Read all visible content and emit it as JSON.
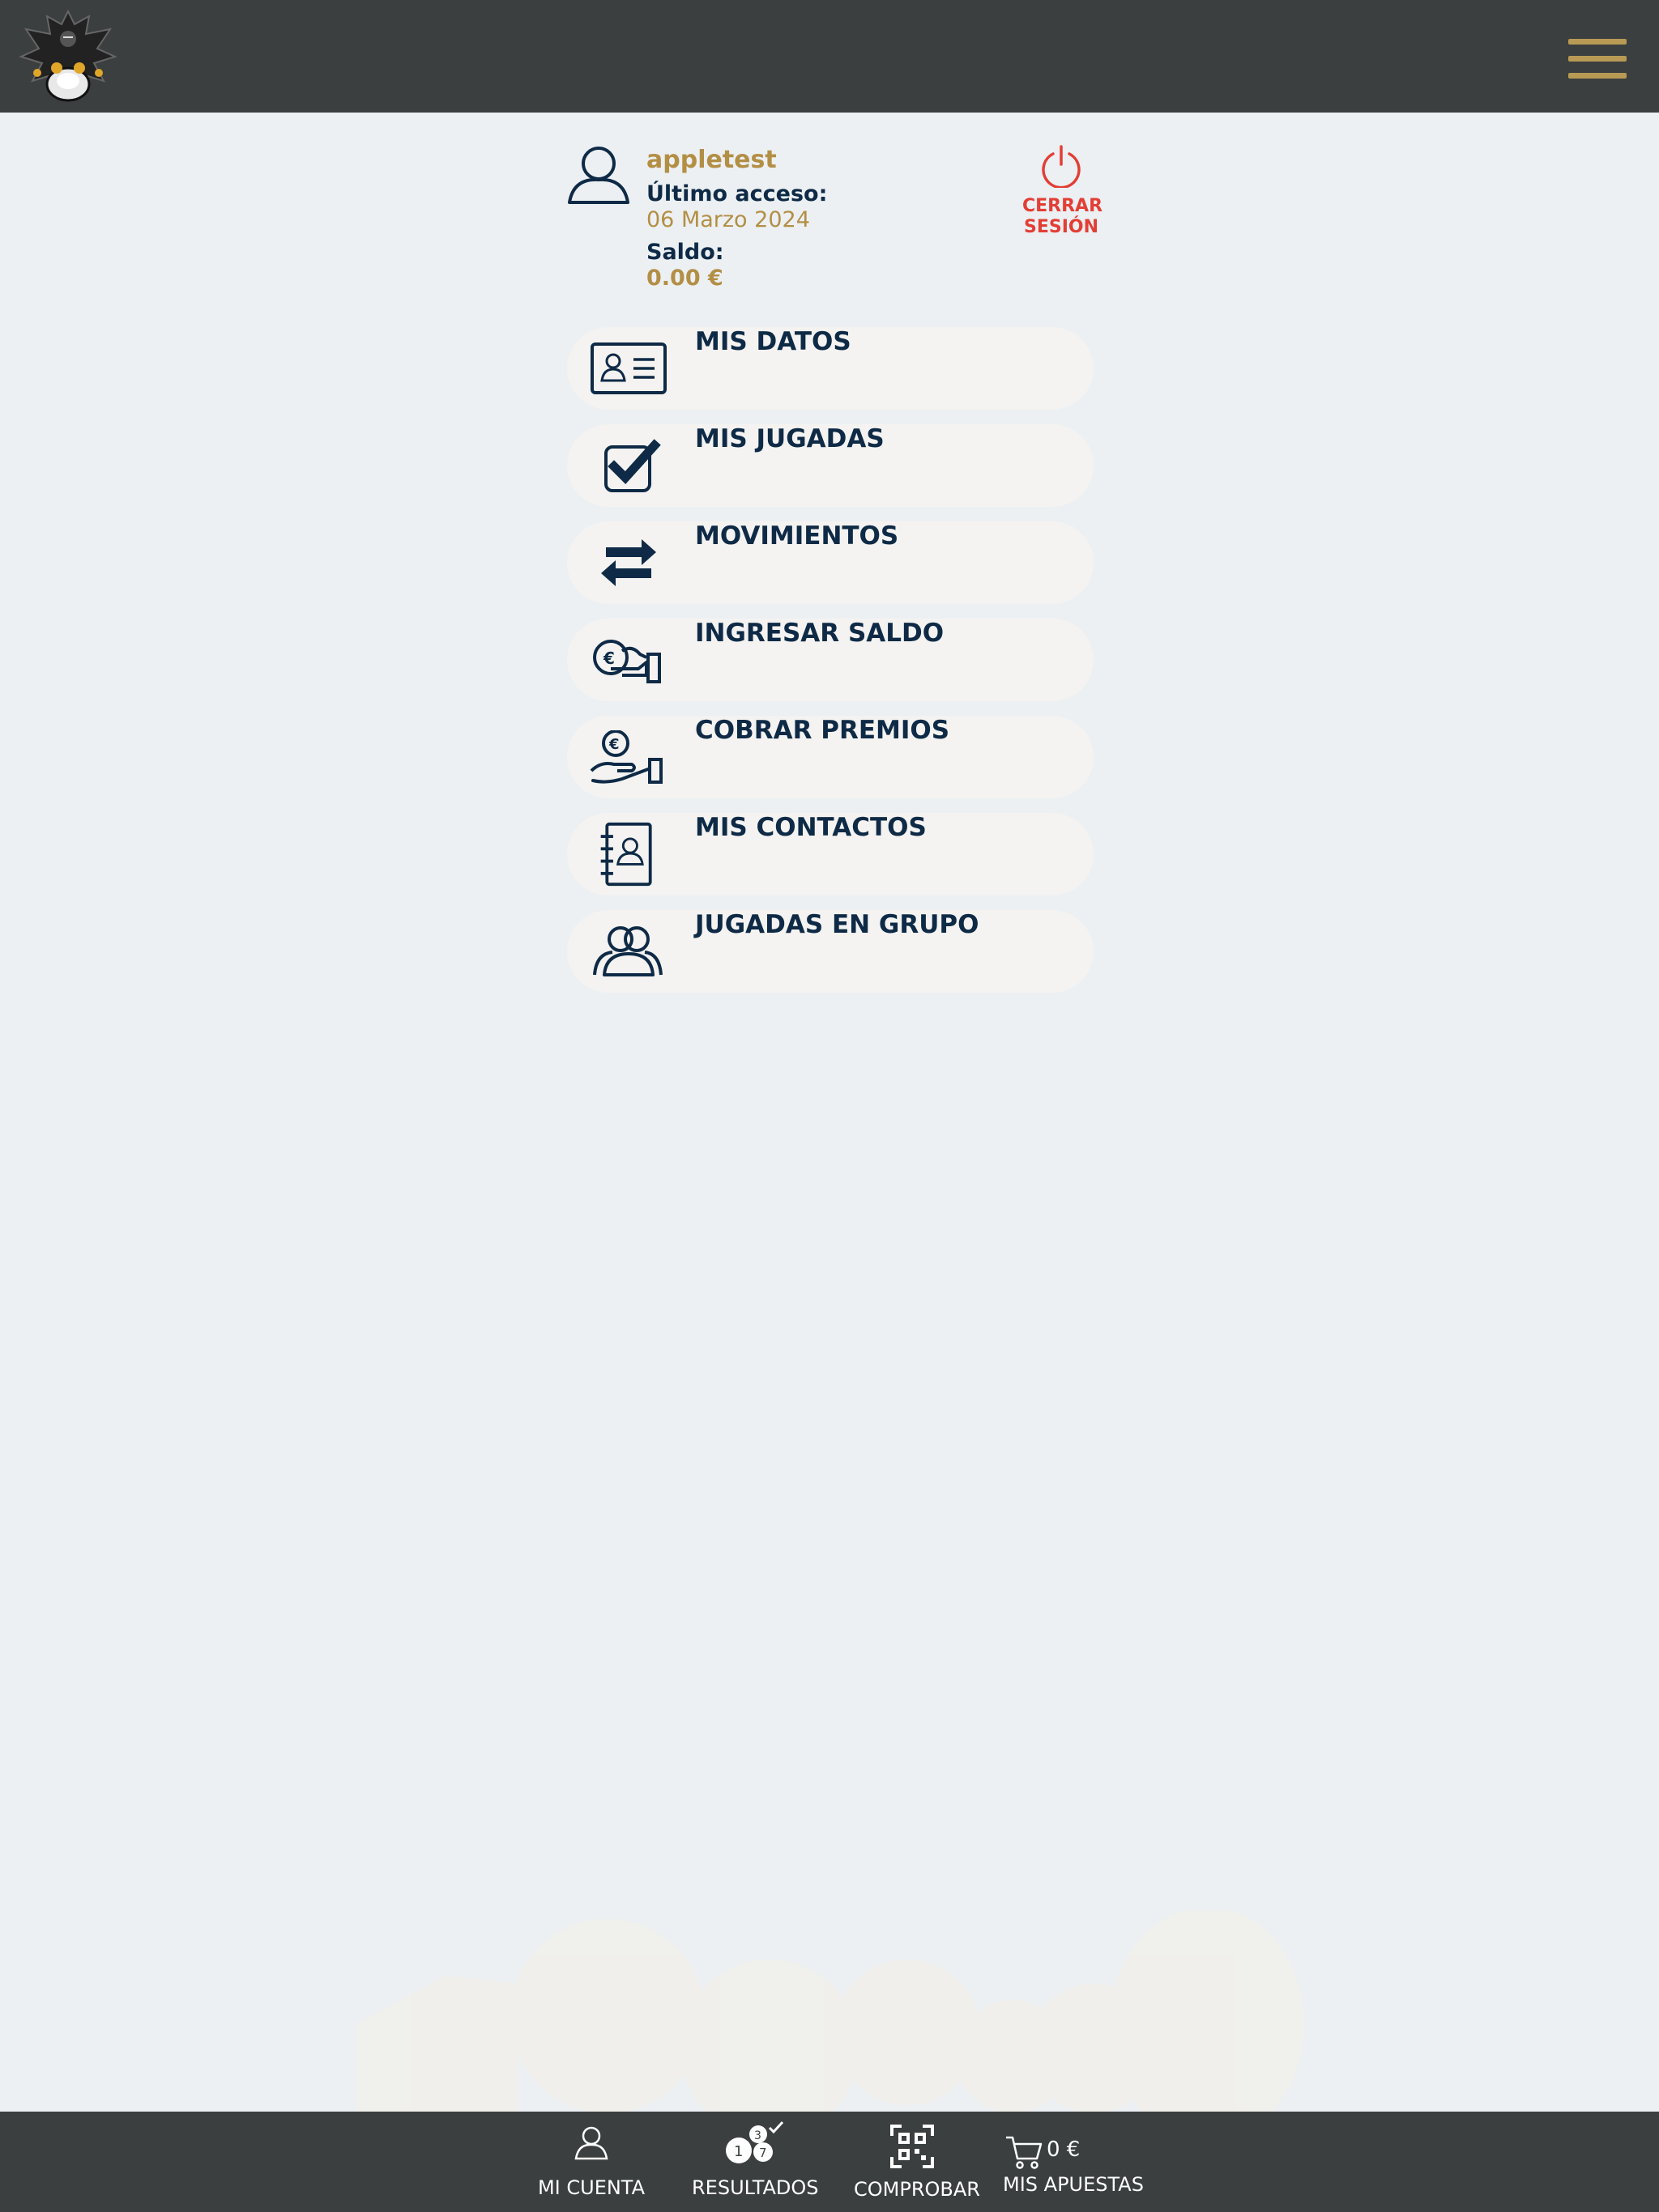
{
  "header": {
    "logo_icon": "dragon-logo-icon",
    "menu_icon": "hamburger-menu-icon",
    "accent_color": "#b89a55"
  },
  "profile": {
    "username": "appletest",
    "last_access_label": "Último acceso:",
    "last_access_value": "06 Marzo 2024",
    "balance_label": "Saldo:",
    "balance_value": "0.00 €",
    "logout_line1": "CERRAR",
    "logout_line2": "SESIÓN",
    "logout_color": "#e33e35"
  },
  "menu": {
    "items": [
      {
        "label": "MIS DATOS",
        "icon": "id-card-icon"
      },
      {
        "label": "MIS JUGADAS",
        "icon": "checkbox-icon"
      },
      {
        "label": "MOVIMIENTOS",
        "icon": "transfer-arrows-icon"
      },
      {
        "label": "INGRESAR SALDO",
        "icon": "deposit-coin-icon"
      },
      {
        "label": "COBRAR PREMIOS",
        "icon": "collect-prize-icon"
      },
      {
        "label": "MIS CONTACTOS",
        "icon": "address-book-icon"
      },
      {
        "label": "JUGADAS EN GRUPO",
        "icon": "group-icon"
      }
    ]
  },
  "bottom_nav": {
    "items": [
      {
        "label": "MI CUENTA",
        "icon": "user-icon"
      },
      {
        "label": "RESULTADOS",
        "icon": "lottery-balls-icon"
      },
      {
        "label": "COMPROBAR",
        "icon": "qr-scan-icon"
      },
      {
        "label": "MIS APUESTAS",
        "icon": "cart-icon"
      }
    ],
    "cart_amount": "0 €",
    "results_balls": [
      "1",
      "3",
      "7"
    ]
  }
}
